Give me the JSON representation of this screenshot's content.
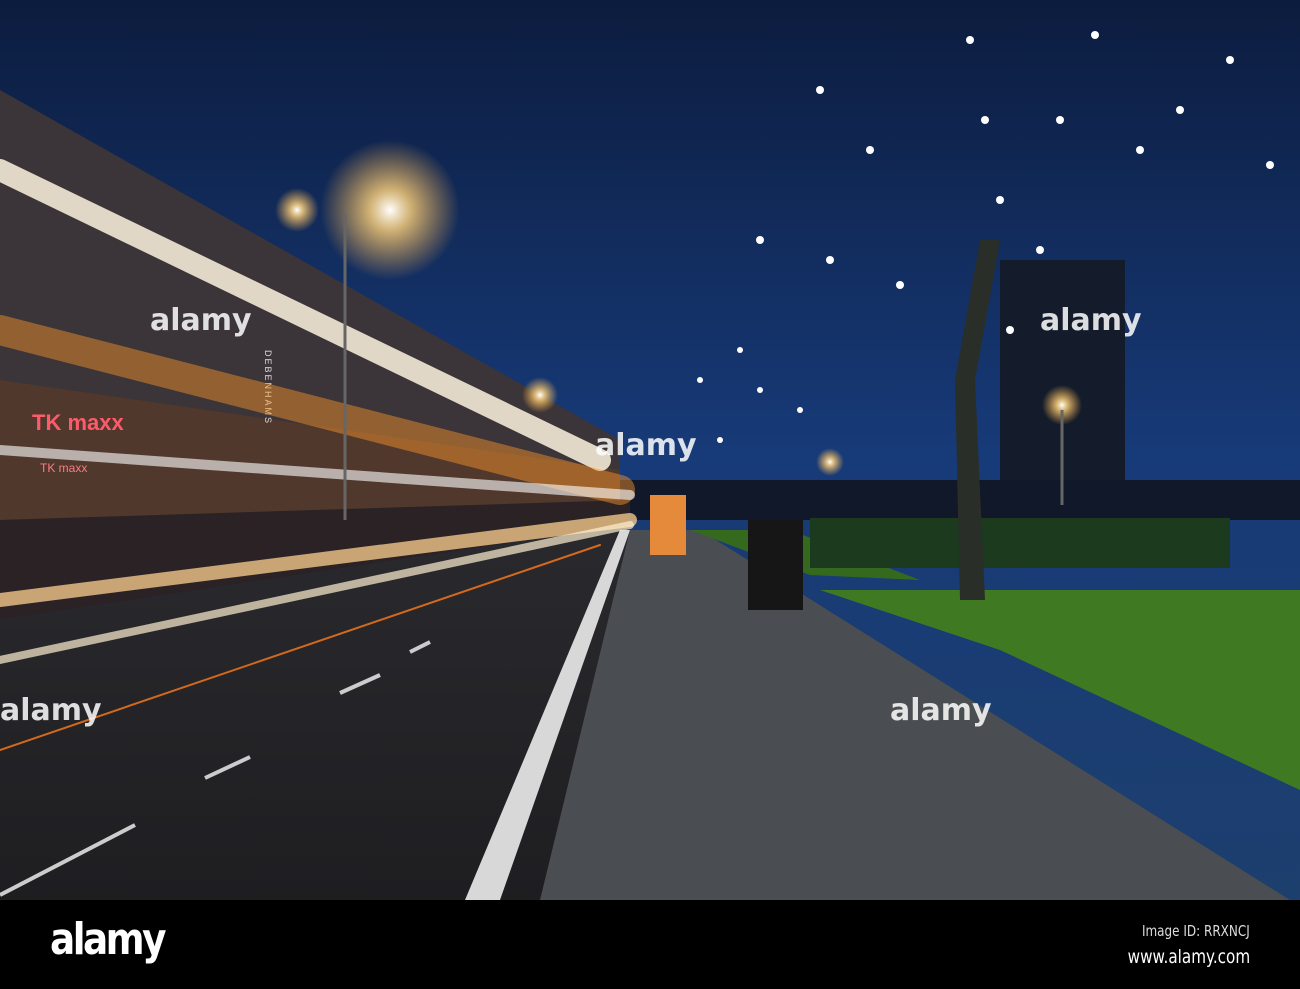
{
  "photo": {
    "description_tag": "night street with light trails",
    "signage": {
      "store_left": "TK maxx",
      "store_left_small": "TK maxx",
      "store_vertical": "DEBENHAMS"
    },
    "colors": {
      "sky": "#0f2550",
      "trail_orange": "#ff9a2a",
      "trail_white": "#fff4e0",
      "grass": "#3f7a22",
      "pavement": "#4a4d52"
    }
  },
  "footer": {
    "logo": "alamy",
    "image_id": "Image ID: RRXNCJ",
    "website": "www.alamy.com"
  }
}
